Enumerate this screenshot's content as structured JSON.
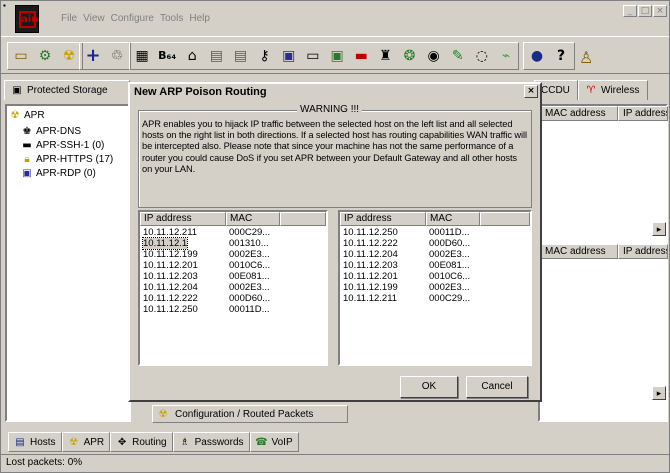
{
  "menu": [
    "File",
    "View",
    "Configure",
    "Tools",
    "Help"
  ],
  "top_tabs": {
    "protected_storage": "Protected Storage",
    "ccdu": "CCDU",
    "wireless": "Wireless"
  },
  "tree": {
    "root": "APR",
    "items": [
      "APR-DNS",
      "APR-SSH-1 (0)",
      "APR-HTTPS (17)",
      "APR-RDP (0)"
    ]
  },
  "right_pane": {
    "header1": [
      "MAC address",
      "IP address"
    ],
    "header2": [
      "MAC address",
      "IP address"
    ]
  },
  "bottom_tab": "Configuration / Routed Packets",
  "nav_tabs": [
    "Hosts",
    "APR",
    "Routing",
    "Passwords",
    "VoIP"
  ],
  "status": "Lost packets:  0%",
  "dialog": {
    "title": "New ARP Poison Routing",
    "warning_title": "WARNING !!!",
    "warning_text": "APR enables you to hijack IP traffic between the selected host on the left list and all selected hosts on the right list in both directions. If a selected host has routing capabilities WAN traffic will be intercepted also. Please note that since your machine has not the same performance of a router you could cause DoS if you set APR between your Default Gateway and all other hosts on your LAN.",
    "left_list": {
      "headers": [
        "IP address",
        "MAC"
      ],
      "rows": [
        [
          "10.11.12.211",
          "000C29..."
        ],
        [
          "10.11.12.1",
          "001310..."
        ],
        [
          "10.11.12.199",
          "0002E3..."
        ],
        [
          "10.11.12.201",
          "0010C6..."
        ],
        [
          "10.11.12.203",
          "00E081..."
        ],
        [
          "10.11.12.204",
          "0002E3..."
        ],
        [
          "10.11.12.222",
          "000D60..."
        ],
        [
          "10.11.12.250",
          "00011D..."
        ]
      ],
      "selected_index": 1
    },
    "right_list": {
      "headers": [
        "IP address",
        "MAC"
      ],
      "rows": [
        [
          "10.11.12.250",
          "00011D..."
        ],
        [
          "10.11.12.222",
          "000D60..."
        ],
        [
          "10.11.12.204",
          "0002E3..."
        ],
        [
          "10.11.12.203",
          "00E081..."
        ],
        [
          "10.11.12.201",
          "0010C6..."
        ],
        [
          "10.11.12.199",
          "0002E3..."
        ],
        [
          "10.11.12.211",
          "000C29..."
        ]
      ]
    },
    "ok": "OK",
    "cancel": "Cancel"
  },
  "colors": {
    "face": "#d4d0c8",
    "shadow": "#808080",
    "logo_red": "#c00000",
    "disabled_text": "#808080"
  }
}
